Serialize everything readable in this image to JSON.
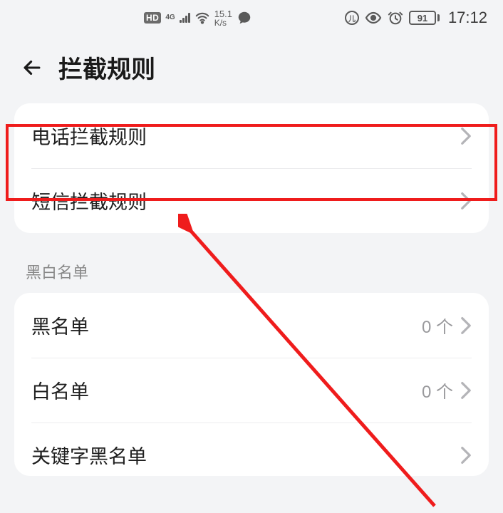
{
  "status": {
    "hd": "HD",
    "net": "4G",
    "speed_top": "15.1",
    "speed_bot": "K/s",
    "battery": "91",
    "time": "17:12"
  },
  "header": {
    "title": "拦截规则"
  },
  "section1": {
    "items": [
      {
        "label": "电话拦截规则"
      },
      {
        "label": "短信拦截规则"
      }
    ]
  },
  "section2": {
    "title": "黑白名单",
    "items": [
      {
        "label": "黑名单",
        "value": "0 个"
      },
      {
        "label": "白名单",
        "value": "0 个"
      },
      {
        "label": "关键字黑名单"
      }
    ]
  }
}
